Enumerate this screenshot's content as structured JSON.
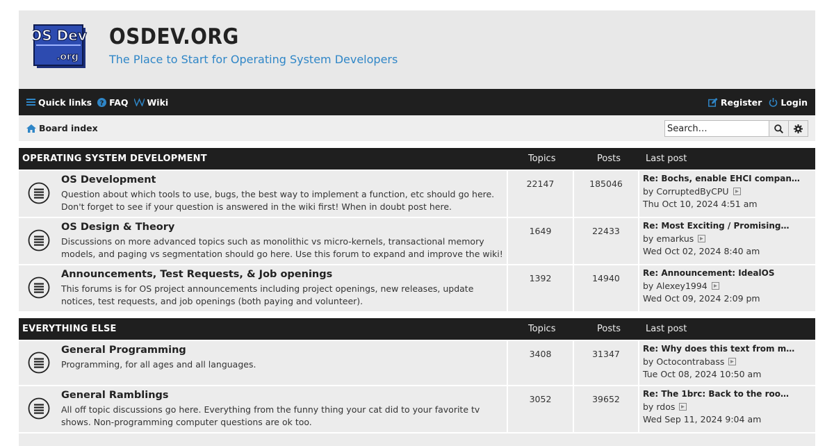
{
  "header": {
    "logo_text_top": "OS Dev",
    "logo_text_bottom": ".org",
    "title": "OSDEV.ORG",
    "description": "The Place to Start for Operating System Developers"
  },
  "navbar": {
    "quick_links": "Quick links",
    "faq": "FAQ",
    "wiki": "Wiki",
    "register": "Register",
    "login": "Login"
  },
  "breadcrumb": {
    "board_index": "Board index"
  },
  "search": {
    "placeholder": "Search…"
  },
  "columns": {
    "topics": "Topics",
    "posts": "Posts",
    "last_post": "Last post"
  },
  "categories": [
    {
      "title": "OPERATING SYSTEM DEVELOPMENT",
      "forums": [
        {
          "name": "OS Development",
          "description": "Question about which tools to use, bugs, the best way to implement a function, etc should go here. Don't forget to see if your question is answered in the wiki first! When in doubt post here.",
          "topics": "22147",
          "posts": "185046",
          "last_title": "Re: Bochs, enable EHCI compan…",
          "last_by": "by",
          "last_author": "CorruptedByCPU",
          "last_time": "Thu Oct 10, 2024 4:51 am"
        },
        {
          "name": "OS Design & Theory",
          "description": "Discussions on more advanced topics such as monolithic vs micro-kernels, transactional memory models, and paging vs segmentation should go here. Use this forum to expand and improve the wiki!",
          "topics": "1649",
          "posts": "22433",
          "last_title": "Re: Most Exciting / Promising…",
          "last_by": "by",
          "last_author": "emarkus",
          "last_time": "Wed Oct 02, 2024 8:40 am"
        },
        {
          "name": "Announcements, Test Requests, & Job openings",
          "description": "This forums is for OS project announcements including project openings, new releases, update notices, test requests, and job openings (both paying and volunteer).",
          "topics": "1392",
          "posts": "14940",
          "last_title": "Re: Announcement: IdealOS",
          "last_by": "by",
          "last_author": "Alexey1994",
          "last_time": "Wed Oct 09, 2024 2:09 pm"
        }
      ]
    },
    {
      "title": "EVERYTHING ELSE",
      "forums": [
        {
          "name": "General Programming",
          "description": "Programming, for all ages and all languages.",
          "topics": "3408",
          "posts": "31347",
          "last_title": "Re: Why does this text from m…",
          "last_by": "by",
          "last_author": "Octocontrabass",
          "last_time": "Tue Oct 08, 2024 10:50 am"
        },
        {
          "name": "General Ramblings",
          "description": "All off topic discussions go here. Everything from the funny thing your cat did to your favorite tv shows. Non-programming computer questions are ok too.",
          "topics": "3052",
          "posts": "39652",
          "last_title": "Re: The 1brc: Back to the roo…",
          "last_by": "by",
          "last_author": "rdos",
          "last_time": "Wed Sep 11, 2024 9:04 am"
        }
      ]
    }
  ],
  "colors": {
    "accent": "#2f86c7",
    "dark_bar": "#1f1f1f",
    "header_bg": "#e8e8e8",
    "row_bg": "#ececec"
  },
  "icons": {
    "quick_links": "bars-icon",
    "faq": "question-circle-icon",
    "wiki": "wikipedia-w-icon",
    "register": "pencil-square-icon",
    "login": "power-icon",
    "board_index": "home-icon",
    "search": "search-icon",
    "advanced_search": "gear-icon",
    "forum": "forum-read-icon",
    "view_post": "view-post-icon"
  }
}
